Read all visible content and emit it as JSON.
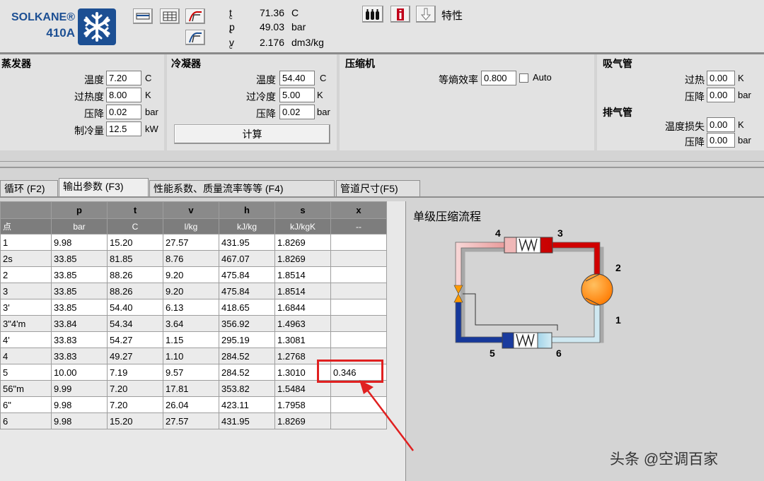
{
  "app": {
    "brand_line1": "SOLKANE®",
    "brand_line2": "410A"
  },
  "header": {
    "tools_right_label": "特性",
    "state": [
      {
        "sym": "t",
        "sub": "c",
        "value": "71.36",
        "unit": "C"
      },
      {
        "sym": "p",
        "sub": "c",
        "value": "49.03",
        "unit": "bar"
      },
      {
        "sym": "v",
        "sub": "c",
        "value": "2.176",
        "unit": "dm3/kg"
      }
    ]
  },
  "evaporator": {
    "title": "蒸发器",
    "fields": [
      {
        "label": "温度",
        "value": "7.20",
        "unit": "C"
      },
      {
        "label": "过热度",
        "value": "8.00",
        "unit": "K"
      },
      {
        "label": "压降",
        "value": "0.02",
        "unit": "bar"
      },
      {
        "label": "制冷量",
        "value": "12.5",
        "unit": "kW"
      }
    ]
  },
  "condenser": {
    "title": "冷凝器",
    "fields": [
      {
        "label": "温度",
        "value": "54.40",
        "unit": "C"
      },
      {
        "label": "过冷度",
        "value": "5.00",
        "unit": "K"
      },
      {
        "label": "压降",
        "value": "0.02",
        "unit": "bar"
      }
    ],
    "calc_label": "计算"
  },
  "compressor": {
    "title": "压缩机",
    "eff_label": "等熵效率",
    "eff_value": "0.800",
    "auto_label": "Auto"
  },
  "suction": {
    "title": "吸气管",
    "fields": [
      {
        "label": "过热",
        "value": "0.00",
        "unit": "K"
      },
      {
        "label": "压降",
        "value": "0.00",
        "unit": "bar"
      }
    ]
  },
  "discharge": {
    "title": "排气管",
    "fields": [
      {
        "label": "温度损失",
        "value": "0.00",
        "unit": "K"
      },
      {
        "label": "压降",
        "value": "0.00",
        "unit": "bar"
      }
    ]
  },
  "tabs": [
    {
      "label": "循环 (F2)"
    },
    {
      "label": "输出参数 (F3)"
    },
    {
      "label": "性能系数、质量流率等等 (F4)"
    },
    {
      "label": "管道尺寸(F5)"
    }
  ],
  "table": {
    "columns": [
      "",
      "p",
      "t",
      "v",
      "h",
      "s",
      "x"
    ],
    "units": [
      "点",
      "bar",
      "C",
      "l/kg",
      "kJ/kg",
      "kJ/kgK",
      "--"
    ],
    "rows": [
      [
        "1",
        "9.98",
        "15.20",
        "27.57",
        "431.95",
        "1.8269",
        ""
      ],
      [
        "2s",
        "33.85",
        "81.85",
        "8.76",
        "467.07",
        "1.8269",
        ""
      ],
      [
        "2",
        "33.85",
        "88.26",
        "9.20",
        "475.84",
        "1.8514",
        ""
      ],
      [
        "3",
        "33.85",
        "88.26",
        "9.20",
        "475.84",
        "1.8514",
        ""
      ],
      [
        "3'",
        "33.85",
        "54.40",
        "6.13",
        "418.65",
        "1.6844",
        ""
      ],
      [
        "3\"4'm",
        "33.84",
        "54.34",
        "3.64",
        "356.92",
        "1.4963",
        ""
      ],
      [
        "4'",
        "33.83",
        "54.27",
        "1.15",
        "295.19",
        "1.3081",
        ""
      ],
      [
        "4",
        "33.83",
        "49.27",
        "1.10",
        "284.52",
        "1.2768",
        ""
      ],
      [
        "5",
        "10.00",
        "7.19",
        "9.57",
        "284.52",
        "1.3010",
        "0.346"
      ],
      [
        "56\"m",
        "9.99",
        "7.20",
        "17.81",
        "353.82",
        "1.5484",
        ""
      ],
      [
        "6\"",
        "9.98",
        "7.20",
        "26.04",
        "423.11",
        "1.7958",
        ""
      ],
      [
        "6",
        "9.98",
        "15.20",
        "27.57",
        "431.95",
        "1.8269",
        ""
      ]
    ]
  },
  "diagram": {
    "title": "单级压缩流程",
    "labels": [
      "4",
      "3",
      "2",
      "1",
      "5",
      "6"
    ]
  },
  "watermark": "头条 @空调百家",
  "colors": {
    "brand_blue": "#1c4f93",
    "hot_red": "#d40000",
    "cold_blue": "#16389a",
    "compressor_orange": "#ff8a00",
    "highlight_red": "#e02020"
  }
}
